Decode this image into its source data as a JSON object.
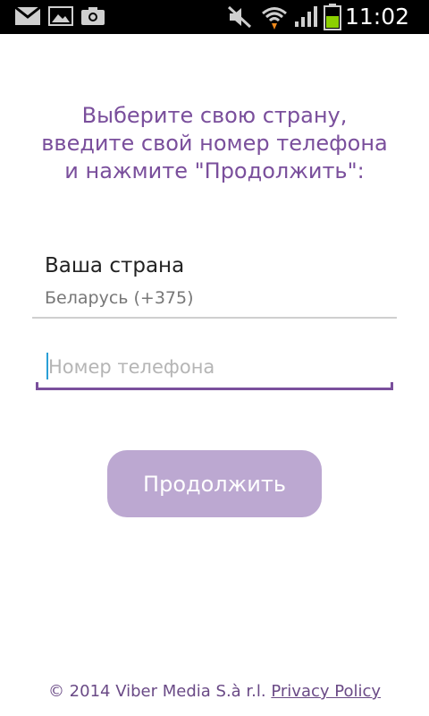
{
  "status_bar": {
    "time": "11:02",
    "icons": [
      "gmail-icon",
      "gallery-icon",
      "camera-icon",
      "mute-icon",
      "wifi-icon",
      "signal-icon",
      "battery-icon"
    ]
  },
  "colors": {
    "accent": "#7a4f9c",
    "button_bg": "#bca8d1",
    "caret": "#2a9fd6"
  },
  "intro": {
    "text": "Выберите свою страну,\nвведите свой номер телефона\nи нажмите \"Продолжить\":"
  },
  "country": {
    "label": "Ваша страна",
    "value": "Беларусь (+375)"
  },
  "phone": {
    "placeholder": "Номер телефона",
    "value": ""
  },
  "continue_button": {
    "label": "Продолжить"
  },
  "footer": {
    "copyright": "© 2014 Viber Media S.à r.l.",
    "privacy_link": "Privacy Policy"
  }
}
